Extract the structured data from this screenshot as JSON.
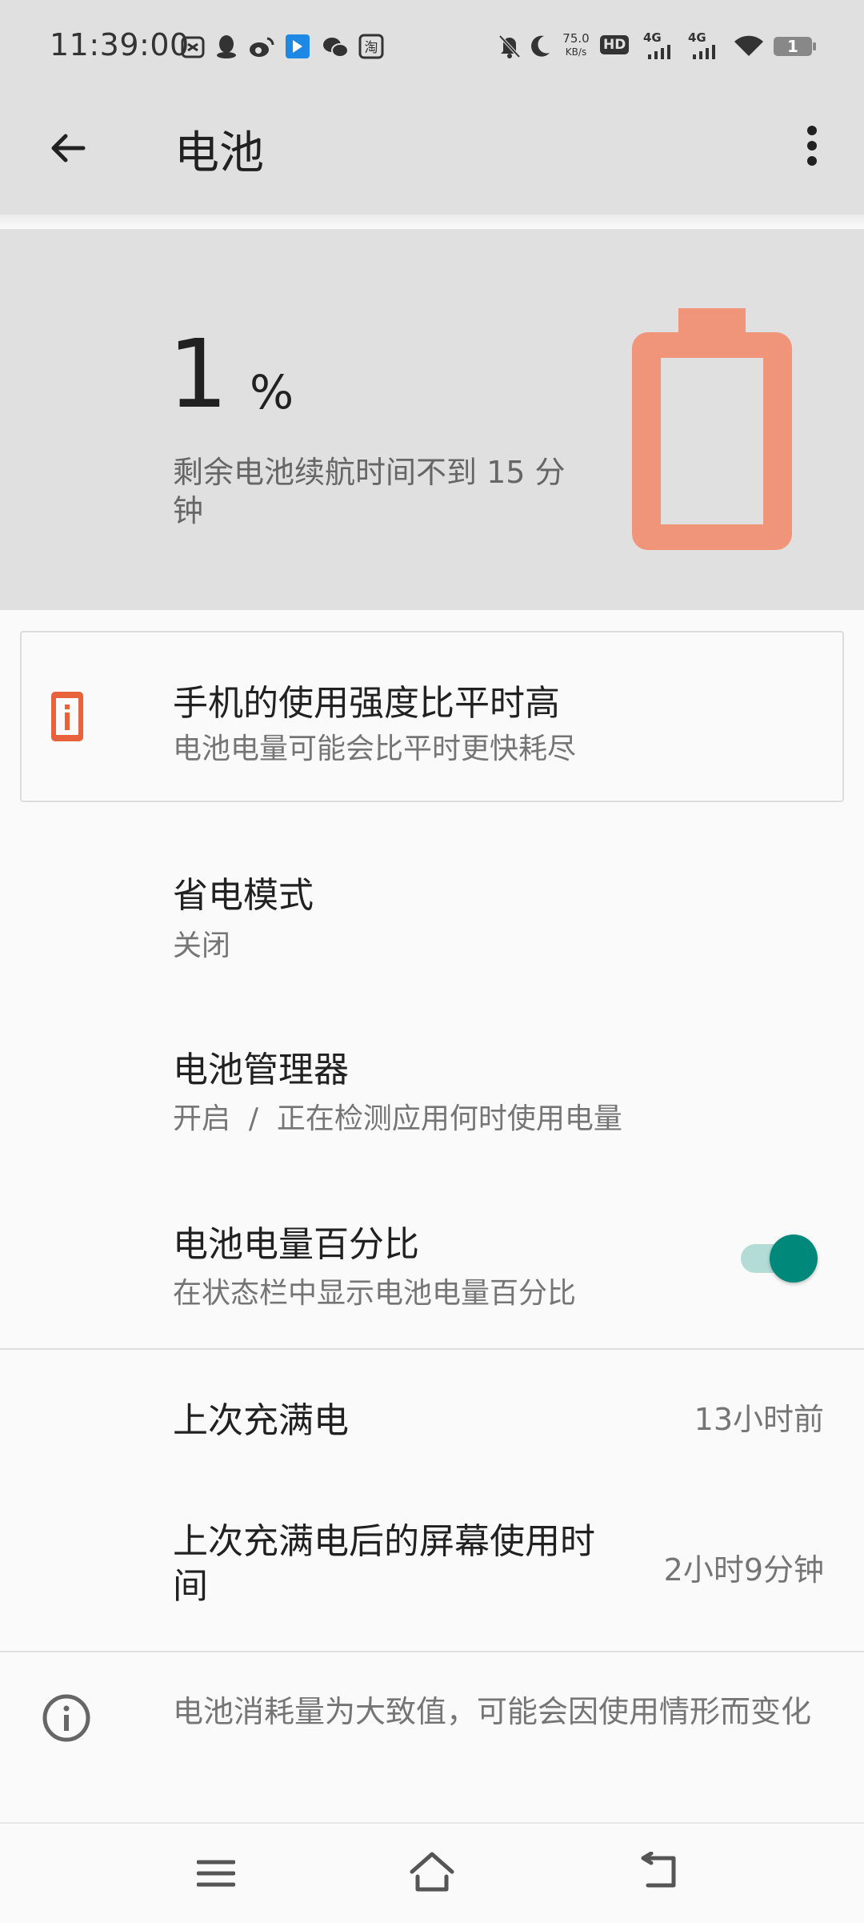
{
  "status_bar": {
    "time": "11:39:00",
    "net_speed_value": "75.0",
    "net_speed_unit": "KB/s",
    "hd_label": "HD",
    "network_1": "4G",
    "network_2": "4G",
    "battery_level": "1",
    "left_icons": [
      "screenshot-icon",
      "qq-icon",
      "weibo-icon",
      "app-icon",
      "wechat-icon",
      "taobao-icon"
    ],
    "right_icons": [
      "bell-off-icon",
      "moon-icon",
      "hd-icon",
      "signal-icon",
      "signal-icon",
      "wifi-icon",
      "battery-icon"
    ]
  },
  "app_bar": {
    "title": "电池",
    "back_icon": "arrow-left-icon",
    "menu_icon": "more-vert-icon"
  },
  "battery": {
    "level_number": "1",
    "level_unit": "%",
    "level_value": 1,
    "remaining_text": "剩余电池续航时间不到  15 分钟",
    "icon_color": "#f0957a"
  },
  "alert_card": {
    "title": "手机的使用强度比平时高",
    "subtitle": "电池电量可能会比平时更快耗尽",
    "icon_color": "#e8623c"
  },
  "settings": [
    {
      "title": "省电模式",
      "subtitle": "关闭"
    },
    {
      "title": "电池管理器",
      "subtitle": "开启  /  正在检测应用何时使用电量"
    },
    {
      "title": "电池电量百分比",
      "subtitle": "在状态栏中显示电池电量百分比",
      "toggle_on": true
    }
  ],
  "toggle": {
    "track_color": "#b3dcd7",
    "thumb_color": "#00897b"
  },
  "stats": [
    {
      "label": "上次充满电",
      "value": "13小时前"
    },
    {
      "label": "上次充满电后的屏幕使用时间",
      "value": "2小时9分钟"
    }
  ],
  "footer_note": "电池消耗量为大致值，可能会因使用情形而变化",
  "nav_bar": {
    "menu_icon": "menu-icon",
    "home_icon": "home-icon",
    "back_icon": "back-icon"
  }
}
